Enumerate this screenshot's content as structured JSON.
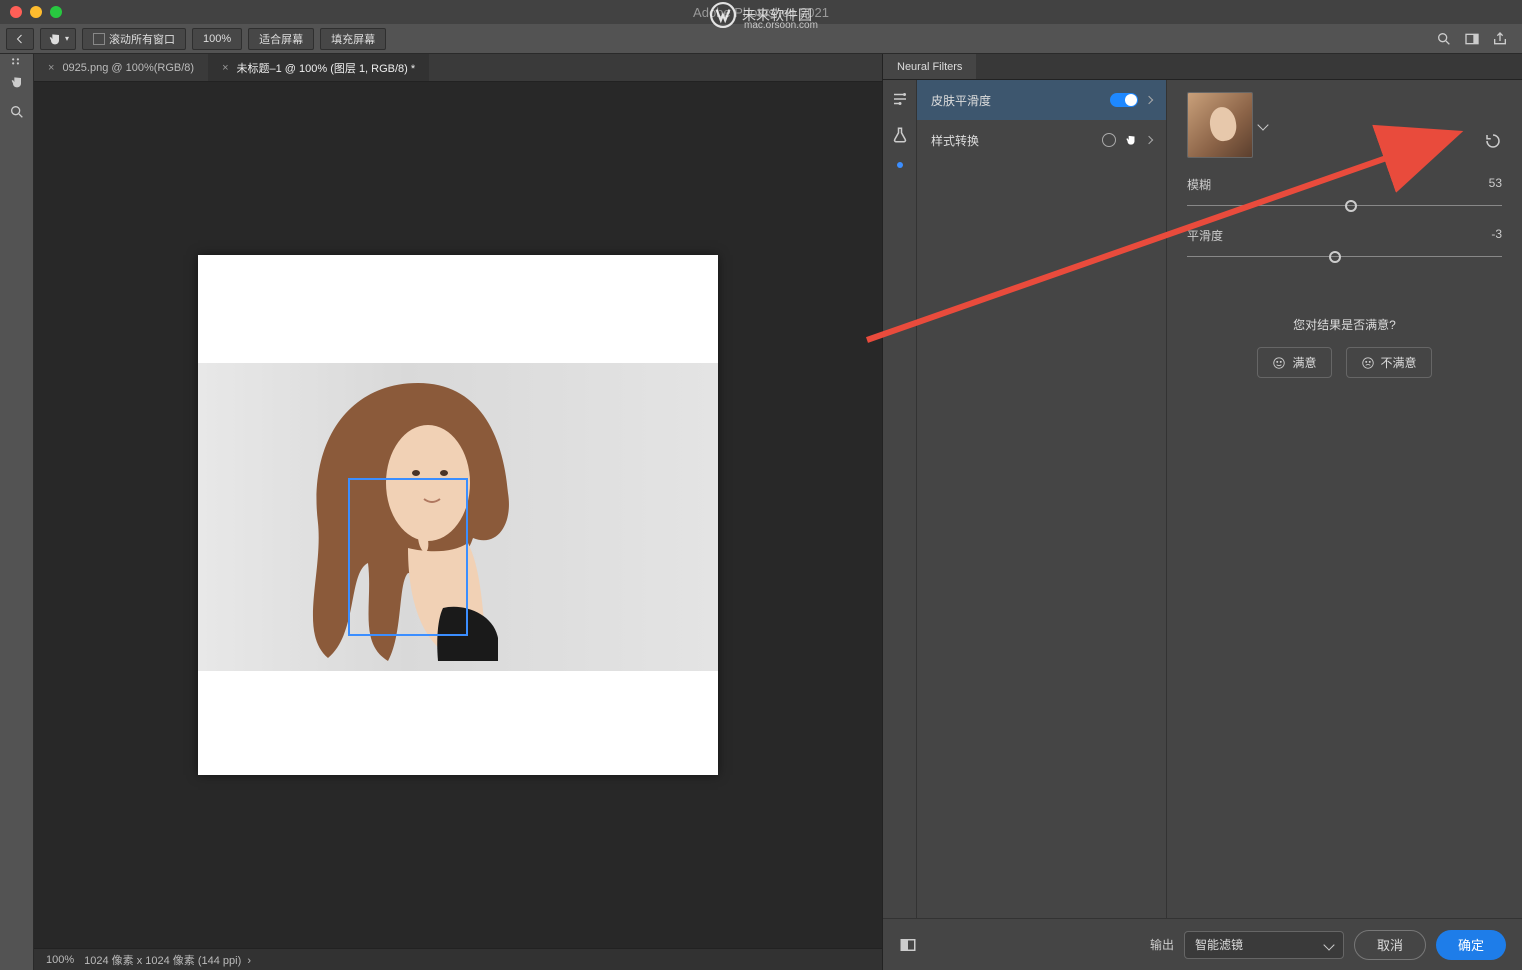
{
  "title": "Adobe Photoshop 2021",
  "watermark": {
    "text": "未来软件园",
    "sub": "mac.orsoon.com"
  },
  "options": {
    "scroll_all": "滚动所有窗口",
    "zoom": "100%",
    "fit_screen": "适合屏幕",
    "fill_screen": "填充屏幕"
  },
  "tabs": [
    {
      "label": "0925.png @ 100%(RGB/8)",
      "active": false
    },
    {
      "label": "未标题–1 @ 100% (图层 1, RGB/8) *",
      "active": true
    }
  ],
  "status": {
    "zoom": "100%",
    "info": "1024 像素 x 1024 像素 (144 ppi)"
  },
  "panel": {
    "title": "Neural Filters",
    "items": [
      {
        "label": "皮肤平滑度",
        "on": true
      },
      {
        "label": "样式转换",
        "on": false
      }
    ],
    "sliders": [
      {
        "label": "模糊",
        "value": 53,
        "pos": 52
      },
      {
        "label": "平滑度",
        "value": -3,
        "pos": 47
      }
    ],
    "feedback": {
      "question": "您对结果是否满意?",
      "yes": "满意",
      "no": "不满意"
    }
  },
  "footer": {
    "output_label": "输出",
    "output_value": "智能滤镜",
    "cancel": "取消",
    "ok": "确定"
  }
}
